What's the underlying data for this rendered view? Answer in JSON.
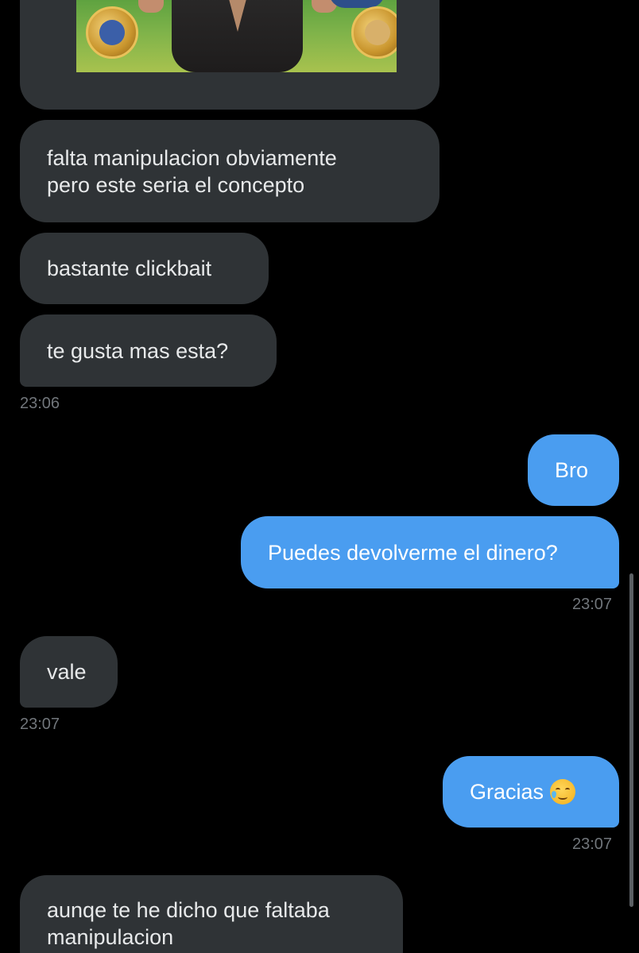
{
  "colors": {
    "background": "#000000",
    "incoming_bubble": "#2f3336",
    "outgoing_bubble": "#4a9df0",
    "timestamp": "#71767b"
  },
  "media": {
    "icon": "image-thumbnail"
  },
  "messages": [
    {
      "direction": "incoming",
      "lines": [
        "falta manipulacion obviamente",
        "pero este seria el concepto"
      ]
    },
    {
      "direction": "incoming",
      "lines": [
        "bastante clickbait"
      ]
    },
    {
      "direction": "incoming",
      "lines": [
        "te gusta mas esta?"
      ],
      "time": "23:06"
    },
    {
      "direction": "outgoing",
      "lines": [
        "Bro"
      ]
    },
    {
      "direction": "outgoing",
      "lines": [
        "Puedes devolverme el dinero?"
      ],
      "time": "23:07"
    },
    {
      "direction": "incoming",
      "lines": [
        "vale"
      ],
      "time": "23:07"
    },
    {
      "direction": "outgoing",
      "lines": [
        "Gracias"
      ],
      "emoji": "face-holding-back-tears-icon",
      "time": "23:07"
    },
    {
      "direction": "incoming",
      "lines": [
        "aunqe te he dicho que faltaba",
        "manipulacion"
      ]
    }
  ]
}
